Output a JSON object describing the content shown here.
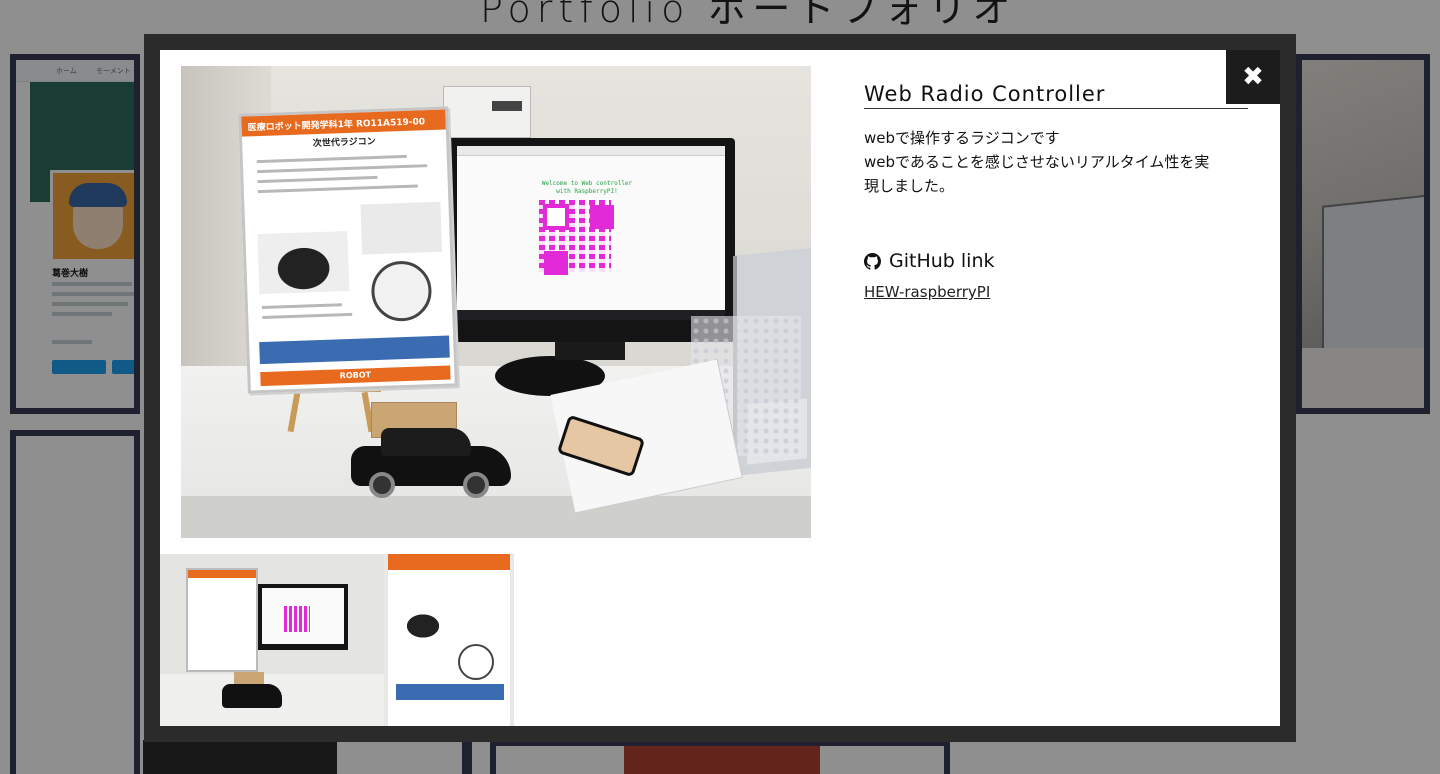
{
  "page": {
    "title": "Portfolio ポートフォリオ"
  },
  "background_tile": {
    "twitter_nav": [
      "ホーム",
      "モーメント"
    ],
    "profile_name": "葛巻大樹"
  },
  "lightbox": {
    "close_icon": "close-icon",
    "photo": {
      "poster_header": "医療ロボット開発学科1年  RO11A519-00",
      "poster_subtitle": "次世代ラジコン",
      "poster_footer": "ROBOT",
      "screen_text": "Welcome to Web controller\nwith RaspberryPI!"
    },
    "thumbnails": [
      "thumbnail-1",
      "thumbnail-2"
    ],
    "info": {
      "title": "Web Radio Controller",
      "description_lines": [
        "webで操作するラジコンです",
        "webであることを感じさせないリアルタイム性を実",
        "現しました。"
      ],
      "github_heading": "GitHub link",
      "github_icon": "github-icon",
      "github_link_text": "HEW-raspberryPI"
    }
  }
}
